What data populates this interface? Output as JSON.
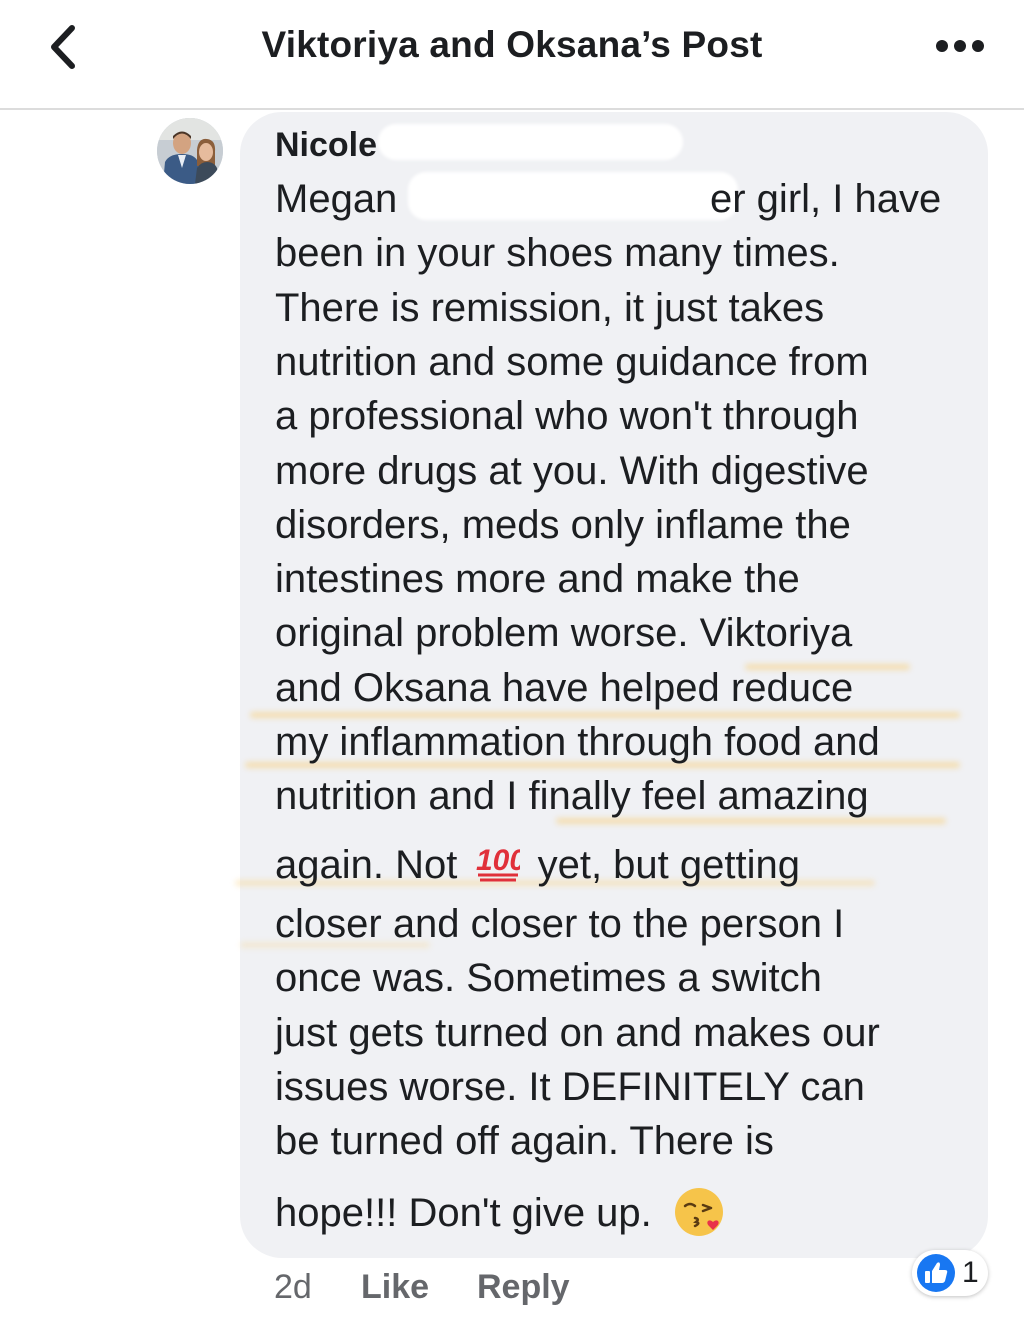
{
  "header": {
    "title": "Viktoriya and Oksana’s Post",
    "back_icon": "chevron-left-icon",
    "more_icon": "more-horizontal-icon"
  },
  "comment": {
    "author": "Nicole",
    "lines": [
      "Megan",
      "er girl, I have",
      "been in your shoes many times.",
      "There is remission, it just takes",
      "nutrition and some guidance from",
      "a professional who won't through",
      "more drugs at you. With digestive",
      "disorders, meds only inflame the",
      "intestines more and make the",
      "original problem worse. Viktoriya",
      "and Oksana have helped reduce",
      "my inflammation through food and",
      "nutrition and I finally feel amazing",
      "again. Not",
      "yet, but getting",
      "closer and closer to the person I",
      "once was. Sometimes a switch",
      "just gets turned on and makes our",
      "issues worse. It DEFINITELY can",
      "be turned off again. There is",
      "hope!!! Don't give up."
    ],
    "emoji_hundred": "hundred-points-emoji",
    "emoji_kiss": "face-blowing-kiss-emoji",
    "bubble_color": "#f0f1f4",
    "highlight_color": "#f8ce78"
  },
  "footer": {
    "time": "2d",
    "like_label": "Like",
    "reply_label": "Reply",
    "reaction_icon": "like-thumb-icon",
    "reaction_count": "1",
    "reaction_color": "#1877f2"
  }
}
